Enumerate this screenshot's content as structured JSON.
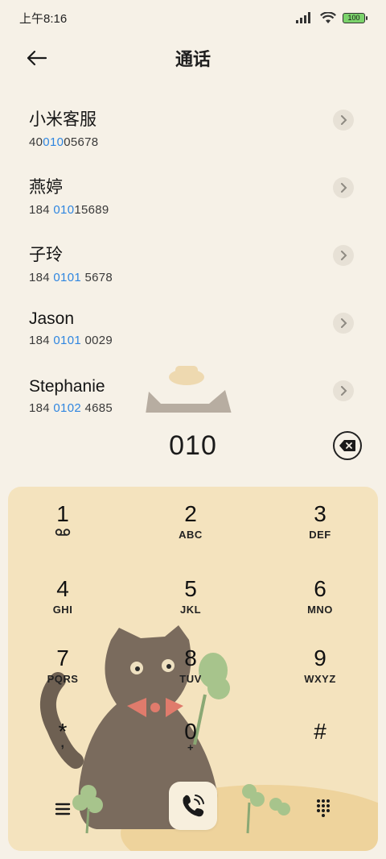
{
  "status": {
    "time": "上午8:16",
    "battery": "100"
  },
  "header": {
    "title": "通话"
  },
  "contacts": [
    {
      "name": "小米客服",
      "num_pre": "40",
      "num_hl": "010",
      "num_post": "05678"
    },
    {
      "name": "燕婷",
      "num_pre": "184 ",
      "num_hl": "010",
      "num_post": "15689"
    },
    {
      "name": "子玲",
      "num_pre": "184 ",
      "num_hl": "0101",
      "num_post": " 5678"
    },
    {
      "name": "Jason",
      "num_pre": "184 ",
      "num_hl": "0101",
      "num_post": " 0029"
    },
    {
      "name": "Stephanie",
      "num_pre": "184 ",
      "num_hl": "0102",
      "num_post": " 4685"
    }
  ],
  "dial": {
    "value": "010"
  },
  "keys": [
    {
      "digit": "1",
      "letters": "ᴑᴑ"
    },
    {
      "digit": "2",
      "letters": "ABC"
    },
    {
      "digit": "3",
      "letters": "DEF"
    },
    {
      "digit": "4",
      "letters": "GHI"
    },
    {
      "digit": "5",
      "letters": "JKL"
    },
    {
      "digit": "6",
      "letters": "MNO"
    },
    {
      "digit": "7",
      "letters": "PQRS"
    },
    {
      "digit": "8",
      "letters": "TUV"
    },
    {
      "digit": "9",
      "letters": "WXYZ"
    },
    {
      "digit": "*",
      "letters": ","
    },
    {
      "digit": "0",
      "letters": "+"
    },
    {
      "digit": "#",
      "letters": ""
    }
  ],
  "colors": {
    "accent_blue": "#2f86e0",
    "keypad_bg": "#f4e3be",
    "page_bg": "#f6f1e7"
  }
}
